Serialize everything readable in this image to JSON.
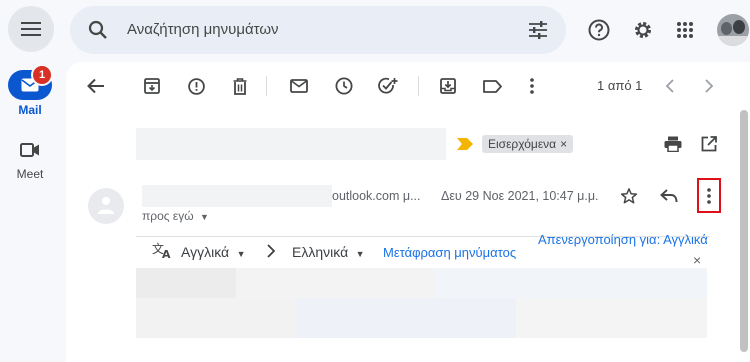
{
  "rail": {
    "mail_label": "Mail",
    "mail_badge": "1",
    "meet_label": "Meet"
  },
  "search": {
    "placeholder": "Αναζήτηση μηνυμάτων"
  },
  "toolbar": {
    "page_count": "1 από 1"
  },
  "message": {
    "label_chip": "Εισερχόμενα",
    "sender_email_partial": "outlook.com μ...",
    "date": "Δευ 29 Νοε 2021, 10:47 μ.μ.",
    "to_me": "προς εγώ"
  },
  "translation": {
    "from_lang": "Αγγλικά",
    "to_lang": "Ελληνικά",
    "translate_link": "Μετάφραση μηνύματος",
    "disable_link": "Απενεργοποίηση για: Αγγλικά"
  },
  "colors": {
    "accent": "#0b57d0",
    "badge": "#d93025",
    "link": "#1a73e8",
    "highlight": "#e0101a",
    "label_arrow": "#f4b400"
  }
}
